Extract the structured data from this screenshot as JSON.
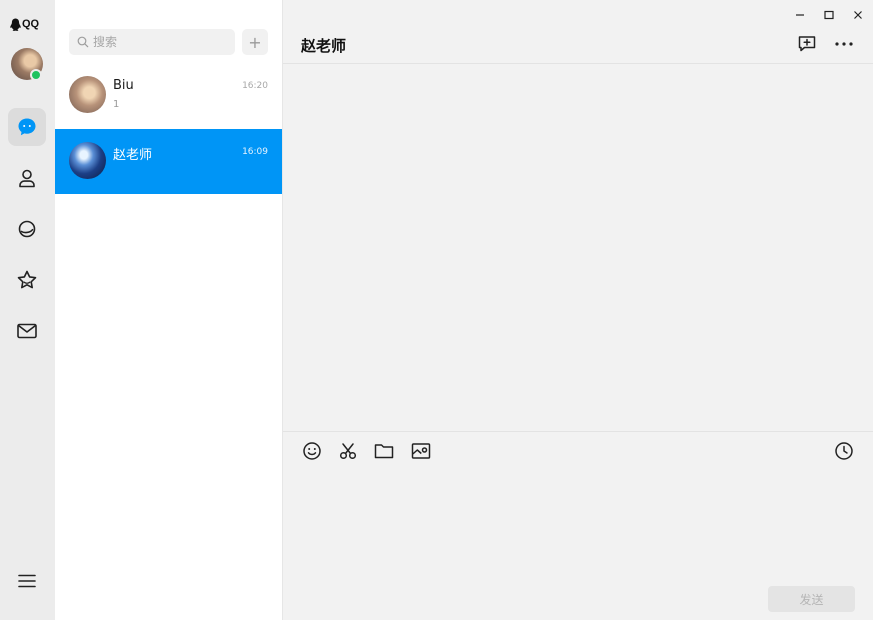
{
  "app": {
    "brand": "QQ"
  },
  "nav": {
    "items": [
      {
        "id": "messages",
        "icon": "chat-bubble-icon",
        "active": true
      },
      {
        "id": "contacts",
        "icon": "person-icon",
        "active": false
      },
      {
        "id": "space",
        "icon": "planet-icon",
        "active": false
      },
      {
        "id": "favorites",
        "icon": "star-icon",
        "active": false
      },
      {
        "id": "mail",
        "icon": "mail-icon",
        "active": false
      }
    ],
    "menu_icon": "hamburger-icon",
    "accent": "#0095f6",
    "online_color": "#1fc35f"
  },
  "list": {
    "search_placeholder": "搜索",
    "add_label": "+",
    "conversations": [
      {
        "name": "Biu",
        "time": "16:20",
        "preview": "1",
        "selected": false
      },
      {
        "name": "赵老师",
        "time": "16:09",
        "preview": "",
        "selected": true
      }
    ]
  },
  "chat": {
    "title": "赵老师",
    "toolbar": [
      "emoji-icon",
      "scissors-icon",
      "folder-icon",
      "image-icon"
    ],
    "history_icon": "clock-icon",
    "send_label": "发送"
  }
}
